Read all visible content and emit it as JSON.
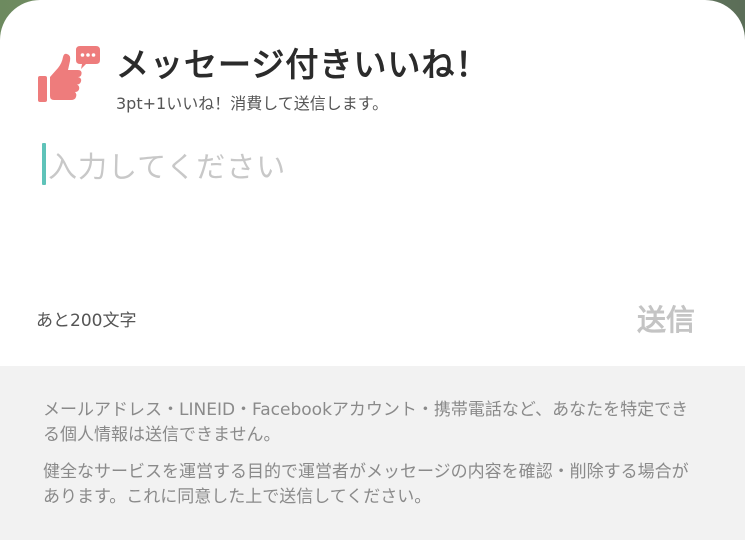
{
  "header": {
    "title": "メッセージ付きいいね！",
    "subtitle": "3pt+1いいね！消費して送信します。",
    "icon": "thumbs-up-chat-icon"
  },
  "compose": {
    "placeholder": "入力してください",
    "value": "",
    "remaining_label": "あと200文字",
    "send_label": "送信",
    "accent_color": "#5fc3b9"
  },
  "notices": [
    "メールアドレス・LINEID・Facebookアカウント・携帯電話など、あなたを特定できる個人情報は送信できません。",
    "健全なサービスを運営する目的で運営者がメッセージの内容を確認・削除する場合があります。これに同意した上で送信してください。"
  ],
  "colors": {
    "icon_red": "#ee7c7c",
    "send_disabled": "#c4c4c4",
    "notice_bg": "#f2f2f2"
  }
}
